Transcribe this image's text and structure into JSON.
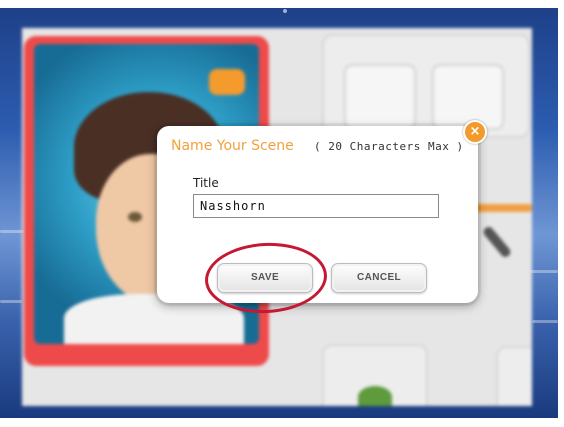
{
  "dialog": {
    "title": "Name Your Scene",
    "subtitle": "( 20 Characters Max )",
    "close_glyph": "×",
    "field_label": "Title",
    "field_value": "Nasshorn",
    "save_label": "SAVE",
    "cancel_label": "CANCEL"
  },
  "colors": {
    "dialog_title": "#f2a03d",
    "close_button": "#f39a2c",
    "highlight_circle": "#c41833",
    "card_frame": "#ef4a4a"
  }
}
